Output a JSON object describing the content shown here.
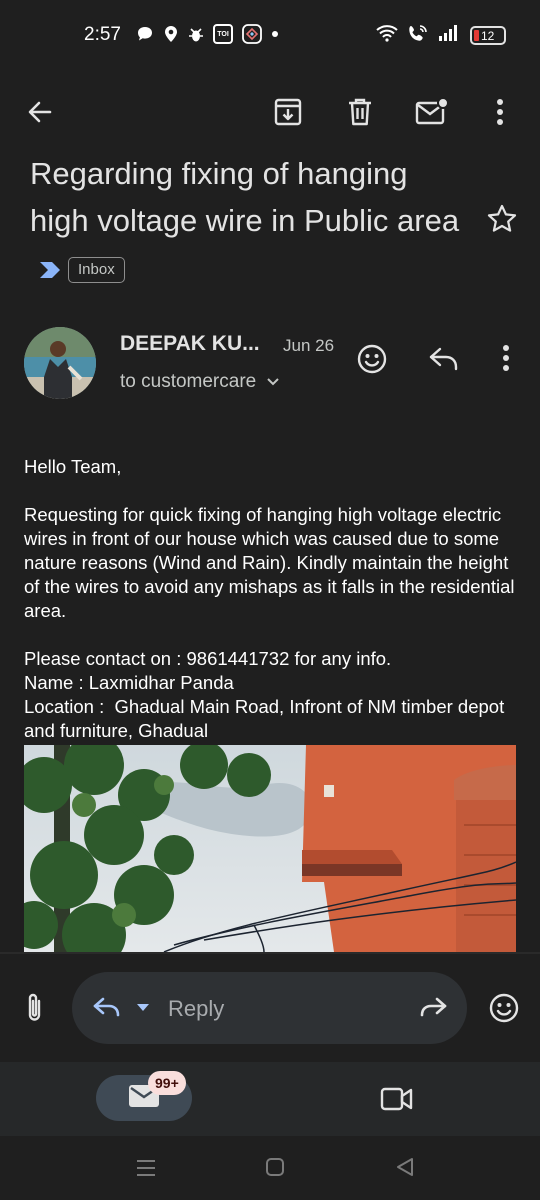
{
  "status_bar": {
    "time": "2:57",
    "toi_label": "TOI",
    "battery_level": "12",
    "battery_color": "#e53935"
  },
  "toolbar": {
    "icons": [
      "back-arrow-icon",
      "archive-icon",
      "delete-icon",
      "mark-unread-icon",
      "more-vert-icon"
    ]
  },
  "email": {
    "subject": "Regarding fixing of hanging high voltage wire in Public area",
    "label": "Inbox",
    "label_arrow_color": "#8ab4f8",
    "sender": "DEEPAK KU...",
    "date": "Jun 26",
    "recipient": "to customercare",
    "body": {
      "greeting": "Hello Team,",
      "paragraph": "Requesting for quick fixing of hanging high voltage electric wires in front of our house which was caused due to some nature reasons (Wind and Rain). Kindly maintain the height of the wires to avoid any mishaps as it falls in the residential area.",
      "contact": "Please contact on : 9861441732 for any info.",
      "name": "Name : Laxmidhar Panda",
      "location": "Location :  Ghadual Main Road, Infront of NM timber depot and furniture, Ghadual"
    }
  },
  "reply_bar": {
    "placeholder": "Reply"
  },
  "bottom_nav": {
    "mail_badge": "99+",
    "mail_pill_color": "#3f4a55"
  }
}
